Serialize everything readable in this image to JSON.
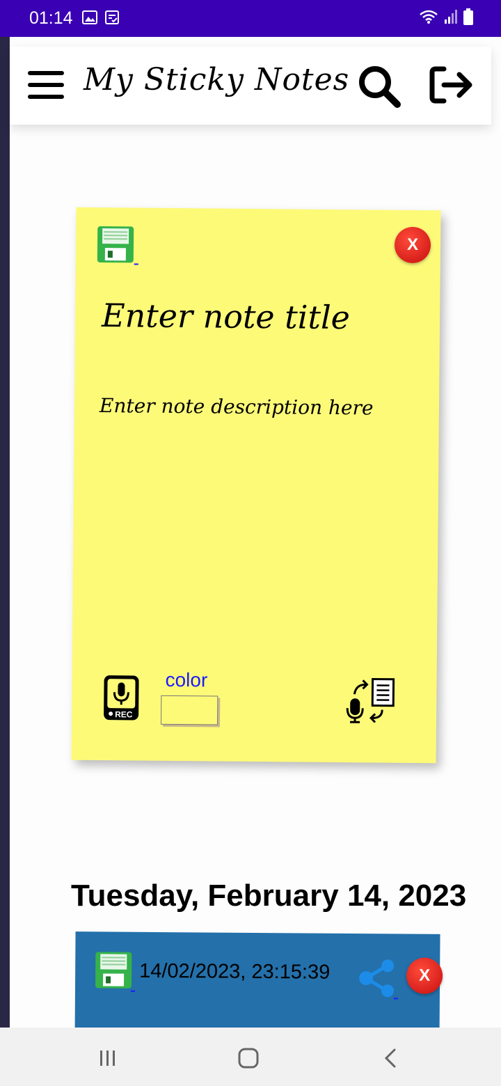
{
  "status_bar": {
    "time": "01:14",
    "left_icons": [
      "image-icon",
      "clipboard-check-icon"
    ],
    "right_icons": [
      "wifi-icon",
      "signal-icon",
      "battery-icon"
    ],
    "color": "#3a00b3"
  },
  "app_bar": {
    "title": "My Sticky Notes",
    "icons": [
      "menu-icon",
      "search-icon",
      "logout-icon"
    ]
  },
  "editor_note": {
    "title_placeholder": "Enter note title",
    "description_placeholder": "Enter note description here",
    "color_label": "color",
    "close_label": "X",
    "icons": [
      "save-icon",
      "close-icon",
      "record-icon",
      "speech-to-text-icon"
    ],
    "background": "#fdfa78"
  },
  "date_heading": "Tuesday, February 14, 2023",
  "saved_note": {
    "timestamp": "14/02/2023, 23:15:39",
    "close_label": "X",
    "icons": [
      "save-icon",
      "share-icon",
      "close-icon"
    ],
    "background": "#2470aa"
  },
  "nav_bar": {
    "icons": [
      "recent-apps-icon",
      "home-icon",
      "back-icon"
    ]
  }
}
